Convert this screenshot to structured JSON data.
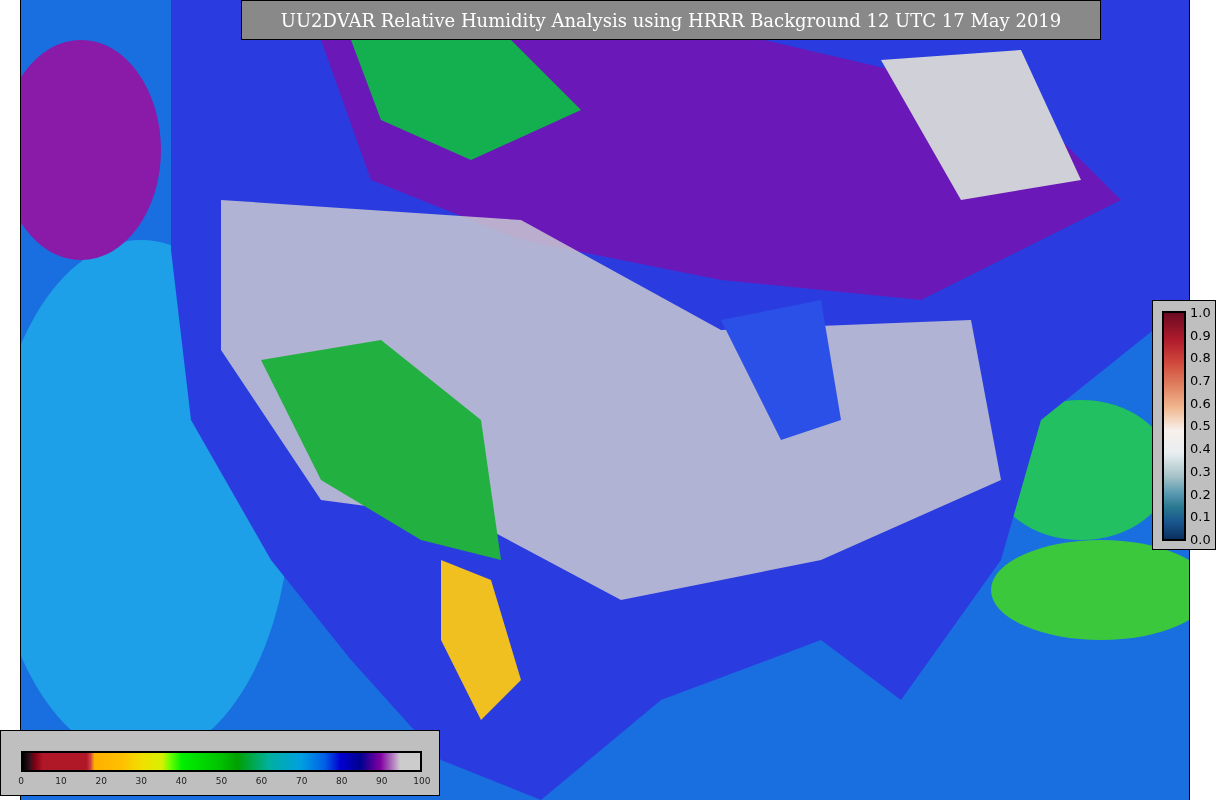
{
  "title": "UU2DVAR Relative Humidity Analysis using HRRR Background 12 UTC 17 May 2019",
  "observation_colorbar": {
    "ticks": [
      "1.0",
      "0.9",
      "0.8",
      "0.7",
      "0.6",
      "0.5",
      "0.4",
      "0.3",
      "0.2",
      "0.1",
      "0.0"
    ]
  },
  "analysis_colorbar": {
    "ticks": [
      "0",
      "10",
      "20",
      "30",
      "40",
      "50",
      "60",
      "70",
      "80",
      "90",
      "100"
    ]
  }
}
